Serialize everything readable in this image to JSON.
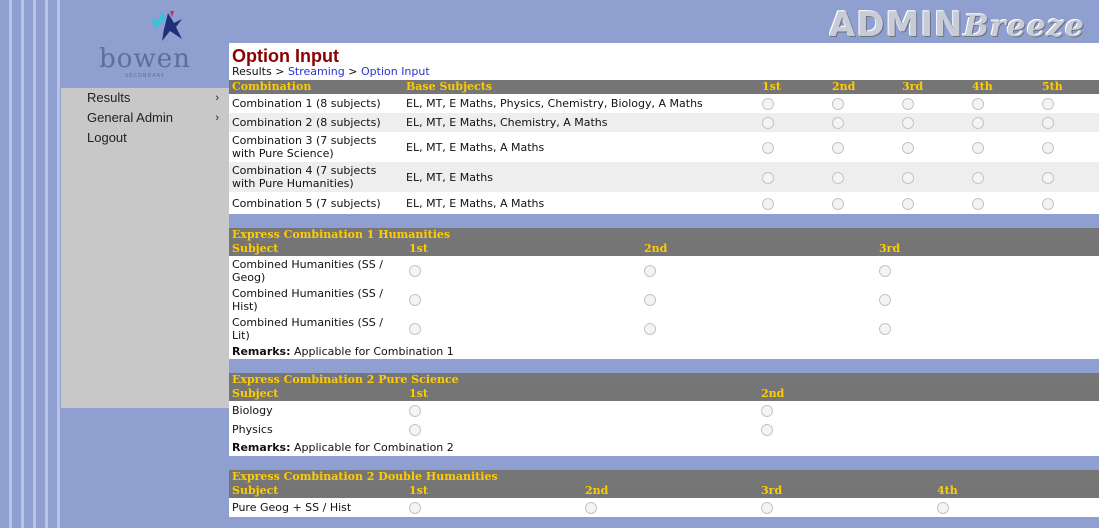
{
  "brand": {
    "logo_text": "bowen",
    "logo_sub": "SECONDARY",
    "app_name_part1": "ADMIN",
    "app_name_part2": "Breeze"
  },
  "nav": {
    "items": [
      {
        "label": "Results",
        "arrow": "›"
      },
      {
        "label": "General Admin",
        "arrow": "›"
      },
      {
        "label": "Logout",
        "arrow": ""
      }
    ]
  },
  "page": {
    "title": "Option Input",
    "breadcrumb": {
      "root": "Results",
      "sep1": " > ",
      "link1": "Streaming",
      "sep2": " > ",
      "link2": "Option Input"
    }
  },
  "combos": {
    "headers": [
      "Combination",
      "Base Subjects",
      "1st",
      "2nd",
      "3rd",
      "4th",
      "5th"
    ],
    "rows": [
      {
        "name": "Combination 1 (8 subjects)",
        "subjects": "EL, MT, E Maths, Physics, Chemistry, Biology, A Maths"
      },
      {
        "name": "Combination 2 (8 subjects)",
        "subjects": "EL, MT, E Maths, Chemistry, A Maths"
      },
      {
        "name": "Combination 3 (7 subjects with Pure Science)",
        "subjects": "EL, MT, E Maths, A Maths"
      },
      {
        "name": "Combination 4 (7 subjects with Pure Humanities)",
        "subjects": "EL, MT, E Maths"
      },
      {
        "name": "Combination 5 (7 subjects)",
        "subjects": "EL, MT, E Maths, A Maths"
      }
    ]
  },
  "section1": {
    "title": "Express Combination 1 Humanities",
    "headers": [
      "Subject",
      "1st",
      "2nd",
      "3rd"
    ],
    "rows": [
      "Combined Humanities (SS / Geog)",
      "Combined Humanities (SS / Hist)",
      "Combined Humanities (SS / Lit)"
    ],
    "remarks_label": "Remarks:",
    "remarks": "Applicable for Combination 1"
  },
  "section2": {
    "title": "Express Combination 2 Pure Science",
    "headers": [
      "Subject",
      "1st",
      "2nd"
    ],
    "rows": [
      "Biology",
      "Physics"
    ],
    "remarks_label": "Remarks:",
    "remarks": "Applicable for Combination 2"
  },
  "section3": {
    "title": "Express Combination 2 Double Humanities",
    "headers": [
      "Subject",
      "1st",
      "2nd",
      "3rd",
      "4th"
    ],
    "rows": [
      "Pure Geog + SS / Hist"
    ]
  }
}
